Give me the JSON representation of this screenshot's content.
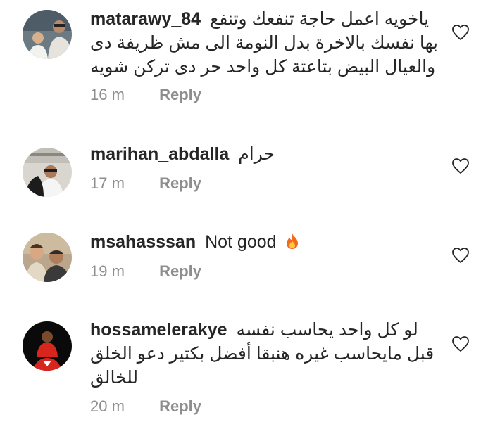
{
  "comments": [
    {
      "username": "matarawy_84",
      "text_line1": "ياخويه اعمل حاجة تنفعك وتنفع",
      "text_line2": "بها نفسك بالاخرة بدل النومة الى مش ظريفة دى",
      "text_line3": "والعيال البيض بتاعتة كل واحد حر دى تركن شويه",
      "time": "16 m",
      "reply": "Reply",
      "like_icon": "heart-outline-icon"
    },
    {
      "username": "marihan_abdalla",
      "text_line1": "حرام",
      "time": "17 m",
      "reply": "Reply",
      "like_icon": "heart-outline-icon"
    },
    {
      "username": "msahasssan",
      "text_line1": "Not good",
      "emoji": "fire-icon",
      "time": "19 m",
      "reply": "Reply",
      "like_icon": "heart-outline-icon"
    },
    {
      "username": "hossamelerakye",
      "text_line1": "لو كل واحد يحاسب نفسه",
      "text_line2": "قبل مايحاسب غيره هنبقا أفضل بكتير دعو الخلق",
      "text_line3": "للخالق",
      "time": "20 m",
      "reply": "Reply",
      "like_icon": "heart-outline-icon"
    }
  ],
  "colors": {
    "text": "#262626",
    "meta": "#8e8e8e",
    "background": "#ffffff"
  }
}
